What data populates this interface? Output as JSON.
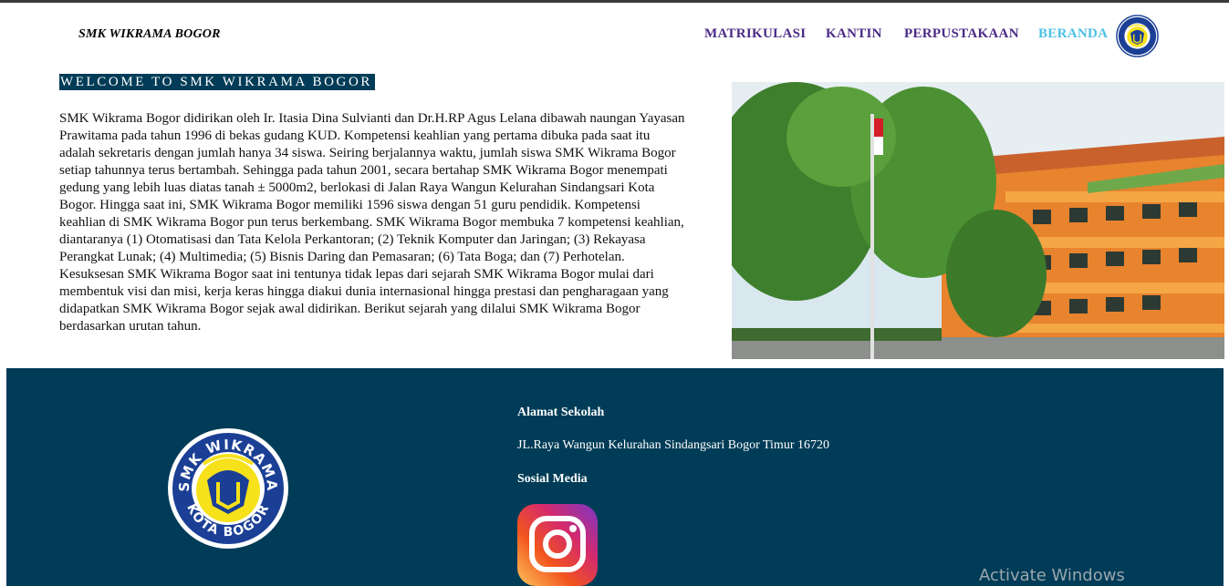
{
  "header": {
    "brand": "SMK WIKRAMA BOGOR",
    "nav": [
      {
        "label": "MATRIKULASI"
      },
      {
        "label": "KANTIN"
      },
      {
        "label": "PERPUSTAKAAN"
      },
      {
        "label": "BERANDA",
        "active": true
      }
    ],
    "logo_icon": "smk-wikrama-logo-icon"
  },
  "main": {
    "welcome": "WELCOME TO SMK WIKRAMA BOGOR",
    "about": "SMK Wikrama Bogor didirikan oleh Ir. Itasia Dina Sulvianti dan Dr.H.RP Agus Lelana dibawah naungan Yayasan Prawitama pada tahun 1996 di bekas gudang KUD. Kompetensi keahlian yang pertama dibuka pada saat itu adalah sekretaris dengan jumlah hanya 34 siswa. Seiring berjalannya waktu, jumlah siswa SMK Wikrama Bogor setiap tahunnya terus bertambah. Sehingga pada tahun 2001, secara bertahap SMK Wikrama Bogor menempati gedung yang lebih luas diatas tanah ± 5000m2, berlokasi di Jalan Raya Wangun Kelurahan Sindangsari Kota Bogor. Hingga saat ini, SMK Wikrama Bogor memiliki 1596 siswa dengan 51 guru pendidik. Kompetensi keahlian di SMK Wikrama Bogor pun terus berkembang. SMK Wikrama Bogor membuka 7 kompetensi keahlian, diantaranya (1) Otomatisasi dan Tata Kelola Perkantoran; (2) Teknik Komputer dan Jaringan; (3) Rekayasa Perangkat Lunak; (4) Multimedia; (5) Bisnis Daring dan Pemasaran; (6) Tata Boga; dan (7) Perhotelan. Kesuksesan SMK Wikrama Bogor saat ini tentunya tidak lepas dari sejarah SMK Wikrama Bogor mulai dari membentuk visi dan misi, kerja keras hingga diakui dunia internasional hingga prestasi dan pengharagaan yang didapatkan SMK Wikrama Bogor sejak awal didirikan. Berikut sejarah yang dilalui SMK Wikrama Bogor berdasarkan urutan tahun."
  },
  "footer": {
    "logo_text_top": "SMK WIKRAMA",
    "logo_text_bottom": "KOTA BOGOR",
    "address_heading": "Alamat Sekolah",
    "address": "JL.Raya Wangun Kelurahan Sindangsari Bogor Timur 16720",
    "social_heading": "Sosial Media",
    "social_icon": "instagram-icon"
  },
  "system": {
    "watermark": "Activate Windows"
  },
  "colors": {
    "footer_bg": "#003c57",
    "nav_text": "#4b2a86",
    "nav_active": "#4dc0e4",
    "logo_blue": "#1b3f95",
    "logo_yellow": "#f6e11b"
  }
}
